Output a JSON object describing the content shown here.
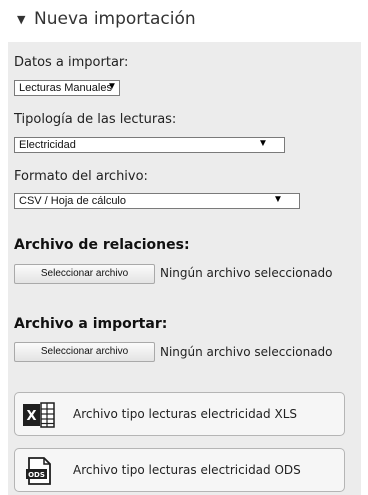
{
  "header": {
    "title": "Nueva importación",
    "caret_icon": "caret-down-icon"
  },
  "form": {
    "datos_label": "Datos a importar:",
    "datos_value": "Lecturas Manuales",
    "tipologia_label": "Tipología de las lecturas:",
    "tipologia_value": "Electricidad",
    "formato_label": "Formato del archivo:",
    "formato_value": "CSV / Hoja de cálculo",
    "dropdown_arrow": "▼"
  },
  "relaciones": {
    "label": "Archivo de relaciones:",
    "button": "Seleccionar archivo",
    "status": "Ningún archivo seleccionado"
  },
  "importar": {
    "label": "Archivo a importar:",
    "button": "Seleccionar archivo",
    "status": "Ningún archivo seleccionado"
  },
  "downloads": [
    {
      "label": "Archivo tipo lecturas electricidad XLS",
      "icon": "excel-file-icon",
      "icon_text": "X"
    },
    {
      "label": "Archivo tipo lecturas electricidad ODS",
      "icon": "ods-file-icon",
      "icon_text": "ODS"
    }
  ]
}
